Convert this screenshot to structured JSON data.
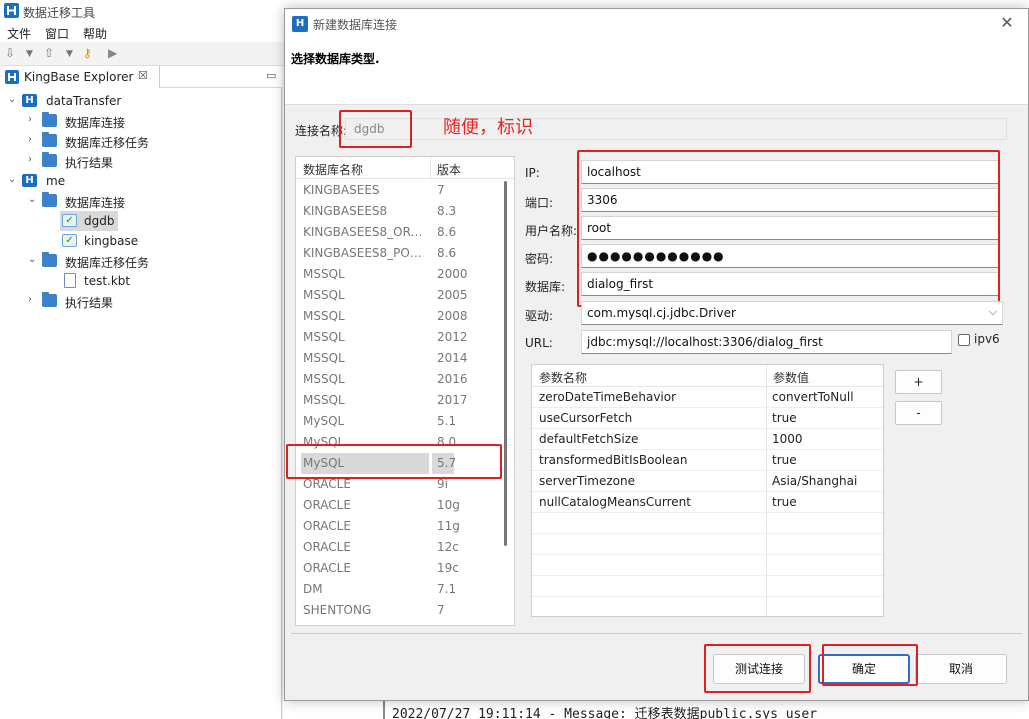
{
  "app": {
    "title": "数据迁移工具",
    "menu": [
      "文件",
      "窗口",
      "帮助"
    ]
  },
  "explorer": {
    "tab_label": "KingBase Explorer",
    "tab_close": "☒",
    "tree": [
      {
        "label": "dataTransfer",
        "expanded": true,
        "icon": "kingbase-project-icon"
      },
      {
        "label": "数据库连接",
        "icon": "folder-icon"
      },
      {
        "label": "数据库迁移任务",
        "icon": "folder-icon"
      },
      {
        "label": "执行结果",
        "icon": "folder-icon"
      },
      {
        "label": "me",
        "expanded": true,
        "icon": "kingbase-project-icon"
      },
      {
        "label": "数据库连接",
        "expanded": true,
        "icon": "folder-icon"
      },
      {
        "label": "dgdb",
        "icon": "database-connection-icon",
        "selected": true
      },
      {
        "label": "kingbase",
        "icon": "database-connection-icon"
      },
      {
        "label": "数据库迁移任务",
        "expanded": true,
        "icon": "folder-icon"
      },
      {
        "label": "test.kbt",
        "icon": "file-icon"
      },
      {
        "label": "执行结果",
        "icon": "folder-icon"
      }
    ]
  },
  "console": {
    "line": "2022/07/27 19:11:14 - Message: 迁移表数据public.sys user"
  },
  "dialog": {
    "title": "新建数据库连接",
    "subtitle": "选择数据库类型.",
    "conn_name_label": "连接名称:",
    "conn_name_value": "dgdb",
    "annotation": "随便，标识",
    "db_list": {
      "col_name": "数据库名称",
      "col_version": "版本",
      "rows": [
        {
          "name": "KINGBASEES",
          "version": "7"
        },
        {
          "name": "KINGBASEES8",
          "version": "8.3"
        },
        {
          "name": "KINGBASEES8_ORA...",
          "version": "8.6"
        },
        {
          "name": "KINGBASEES8_POS...",
          "version": "8.6"
        },
        {
          "name": "MSSQL",
          "version": "2000"
        },
        {
          "name": "MSSQL",
          "version": "2005"
        },
        {
          "name": "MSSQL",
          "version": "2008"
        },
        {
          "name": "MSSQL",
          "version": "2012"
        },
        {
          "name": "MSSQL",
          "version": "2014"
        },
        {
          "name": "MSSQL",
          "version": "2016"
        },
        {
          "name": "MSSQL",
          "version": "2017"
        },
        {
          "name": "MySQL",
          "version": "5.1"
        },
        {
          "name": "MySQL",
          "version": "8.0"
        },
        {
          "name": "MySQL",
          "version": "5.7",
          "selected": true
        },
        {
          "name": "ORACLE",
          "version": "9i"
        },
        {
          "name": "ORACLE",
          "version": "10g"
        },
        {
          "name": "ORACLE",
          "version": "11g"
        },
        {
          "name": "ORACLE",
          "version": "12c"
        },
        {
          "name": "ORACLE",
          "version": "19c"
        },
        {
          "name": "DM",
          "version": "7.1"
        },
        {
          "name": "SHENTONG",
          "version": "7"
        }
      ]
    },
    "form": {
      "ip_label": "IP:",
      "ip_value": "localhost",
      "port_label": "端口:",
      "port_value": "3306",
      "user_label": "用户名称:",
      "user_value": "root",
      "password_label": "密码:",
      "password_value": "●●●●●●●●●●●●",
      "database_label": "数据库:",
      "database_value": "dialog_first",
      "driver_label": "驱动:",
      "driver_value": "com.mysql.cj.jdbc.Driver",
      "url_label": "URL:",
      "url_value": "jdbc:mysql://localhost:3306/dialog_first",
      "ipv6_label": "ipv6"
    },
    "params": {
      "col_name": "参数名称",
      "col_value": "参数值",
      "rows": [
        {
          "name": "zeroDateTimeBehavior",
          "value": "convertToNull"
        },
        {
          "name": "useCursorFetch",
          "value": "true"
        },
        {
          "name": "defaultFetchSize",
          "value": "1000"
        },
        {
          "name": "transformedBitIsBoolean",
          "value": "true"
        },
        {
          "name": "serverTimezone",
          "value": "Asia/Shanghai"
        },
        {
          "name": "nullCatalogMeansCurrent",
          "value": "true"
        }
      ],
      "add_label": "+",
      "remove_label": "-"
    },
    "buttons": {
      "test": "测试连接",
      "ok": "确定",
      "cancel": "取消"
    }
  },
  "colors": {
    "annotation_red": "#e02020",
    "accent_blue": "#2f6fc6"
  }
}
